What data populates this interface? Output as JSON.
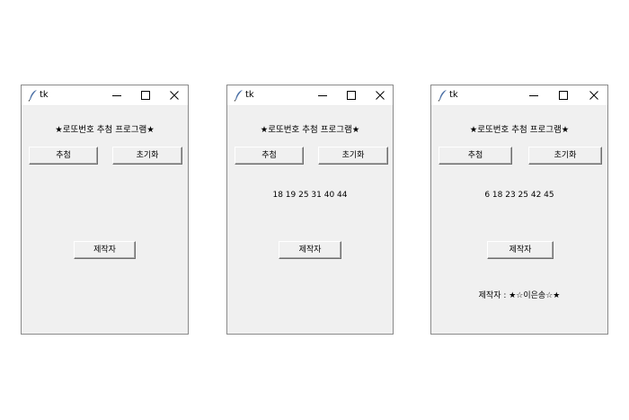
{
  "windows": [
    {
      "title": "tk",
      "heading": "★로또번호 추첨 프로그램★",
      "draw_button": "추첨",
      "reset_button": "초기화",
      "numbers": "",
      "maker_button": "제작자",
      "maker_text": ""
    },
    {
      "title": "tk",
      "heading": "★로또번호 추첨 프로그램★",
      "draw_button": "추첨",
      "reset_button": "초기화",
      "numbers": "18 19 25 31 40 44",
      "maker_button": "제작자",
      "maker_text": ""
    },
    {
      "title": "tk",
      "heading": "★로또번호 추첨 프로그램★",
      "draw_button": "추첨",
      "reset_button": "초기화",
      "numbers": "6 18 23 25 42 45",
      "maker_button": "제작자",
      "maker_text": "제작자 : ★☆이은송☆★"
    }
  ],
  "colors": {
    "window_bg": "#f0f0f0",
    "titlebar_bg": "#ffffff",
    "border": "#8a8a8a",
    "feather_icon": "#4a6fa5"
  }
}
